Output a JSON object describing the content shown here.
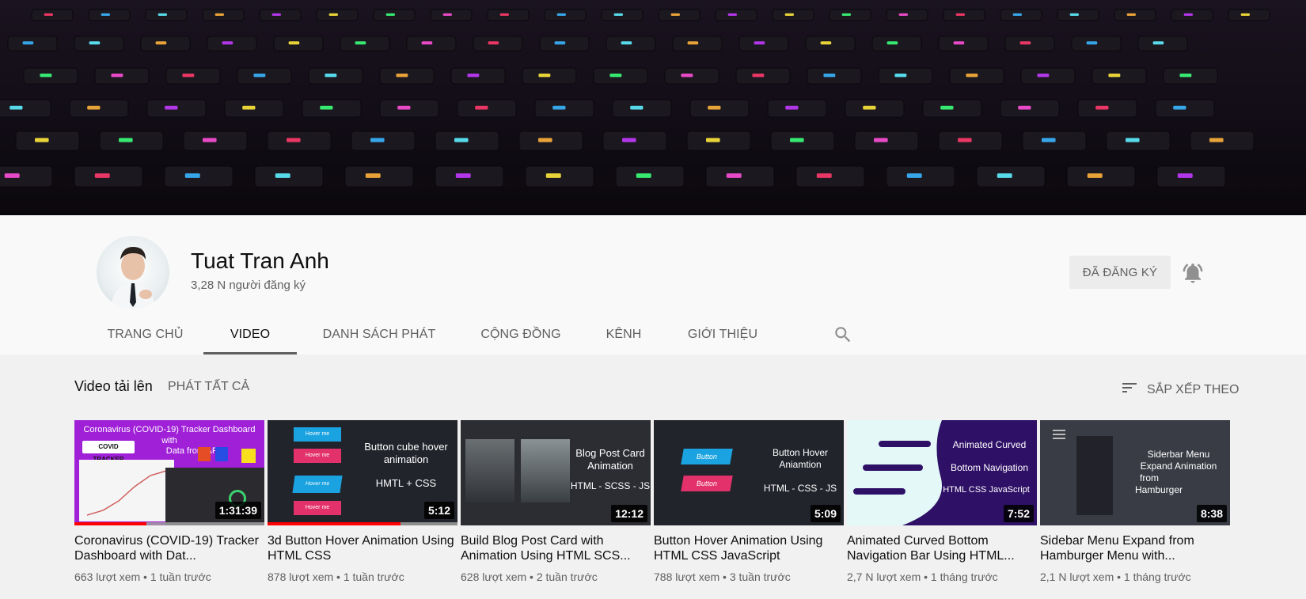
{
  "channel": {
    "name": "Tuat Tran Anh",
    "subscribers": "3,28 N người đăng ký",
    "subscribe_label": "ĐÃ ĐĂNG KÝ"
  },
  "tabs": [
    {
      "label": "TRANG CHỦ",
      "active": false
    },
    {
      "label": "VIDEO",
      "active": true
    },
    {
      "label": "DANH SÁCH PHÁT",
      "active": false
    },
    {
      "label": "CỘNG ĐỒNG",
      "active": false
    },
    {
      "label": "KÊNH",
      "active": false
    },
    {
      "label": "GIỚI THIỆU",
      "active": false
    }
  ],
  "section": {
    "title": "Video tải lên",
    "play_all": "PHÁT TẤT CẢ",
    "sort_label": "SẮP XẾP THEO"
  },
  "videos": [
    {
      "title": "Coronavirus (COVID-19) Tracker Dashboard with Dat...",
      "meta": "663 lượt xem • 1 tuần trước",
      "duration": "1:31:39",
      "watched_fraction": 0.38,
      "thumb_text": [
        "Coronavirus (COVID-19) Tracker Dashboard",
        "with",
        "Data from API",
        "COVID TRACKER"
      ]
    },
    {
      "title": "3d Button Hover Animation Using HTML CSS",
      "meta": "878 lượt xem • 1 tuần trước",
      "duration": "5:12",
      "watched_fraction": 0.7,
      "thumb_text": [
        "Button cube hover",
        "animation",
        "HMTL + CSS",
        "Hover me",
        "Hover me",
        "Hover me",
        "Hover me"
      ]
    },
    {
      "title": "Build Blog Post Card with Animation Using HTML SCS...",
      "meta": "628 lượt xem • 2 tuần trước",
      "duration": "12:12",
      "watched_fraction": 0,
      "thumb_text": [
        "Blog Post Card",
        "Animation",
        "HTML - SCSS - JS"
      ]
    },
    {
      "title": "Button Hover Animation Using HTML CSS JavaScript",
      "meta": "788 lượt xem • 3 tuần trước",
      "duration": "5:09",
      "watched_fraction": 0,
      "thumb_text": [
        "Button Hover",
        "Aniamtion",
        "HTML - CSS - JS",
        "Button",
        "Button"
      ]
    },
    {
      "title": "Animated Curved Bottom Navigation Bar Using HTML...",
      "meta": "2,7 N lượt xem • 1 tháng trước",
      "duration": "7:52",
      "watched_fraction": 0,
      "thumb_text": [
        "Animated Curved",
        "Bottom Navigation",
        "HTML CSS JavaScript"
      ]
    },
    {
      "title": "Sidebar Menu Expand from Hamburger Menu with...",
      "meta": "2,1 N lượt xem • 1 tháng trước",
      "duration": "8:38",
      "watched_fraction": 0,
      "thumb_text": [
        "Siderbar Menu",
        "Expand Animation",
        "from",
        "Hamburger"
      ]
    }
  ],
  "colors": {
    "accent_red": "#ff0000",
    "header_bg": "#f9f9f9",
    "page_bg": "#f1f1f1",
    "muted_text": "#606060"
  },
  "icons": {
    "bell": "bell-icon",
    "search": "search-icon",
    "sort": "sort-icon"
  }
}
